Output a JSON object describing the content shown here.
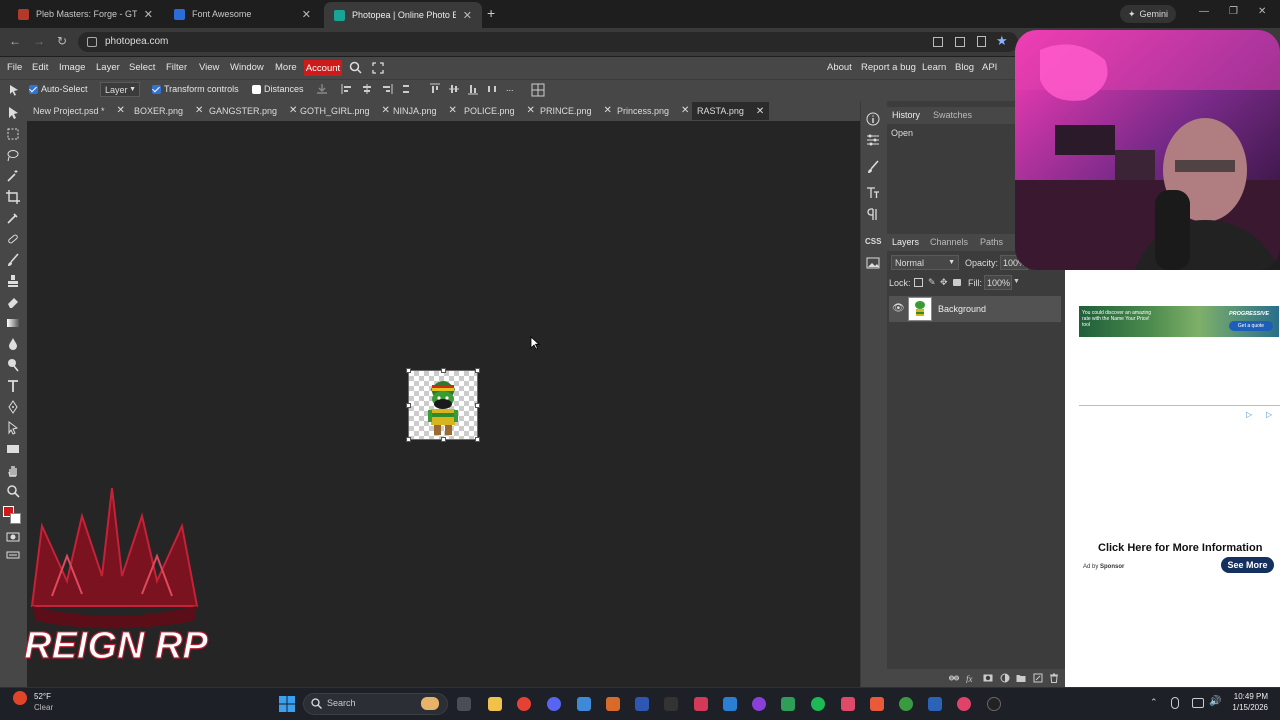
{
  "browser": {
    "tabs": [
      {
        "label": "Pleb Masters: Forge - GTA V Ol",
        "favicon_color": "#b33a2a",
        "active": false
      },
      {
        "label": "Font Awesome",
        "favicon_color": "#2b6cd8",
        "active": false
      },
      {
        "label": "Photopea | Online Photo Editor",
        "favicon_color": "#18a497",
        "active": true
      }
    ],
    "new_tab": "+",
    "gemini_label": "Gemini",
    "url": "photopea.com"
  },
  "photopea": {
    "menu": [
      "File",
      "Edit",
      "Image",
      "Layer",
      "Select",
      "Filter",
      "View",
      "Window",
      "More"
    ],
    "account_label": "Account",
    "right_links": [
      "About",
      "Report a bug",
      "Learn",
      "Blog",
      "API"
    ],
    "options": {
      "auto_select_label": "Auto-Select",
      "auto_select_checked": true,
      "layer_mode": "Layer",
      "transform_controls_label": "Transform controls",
      "transform_controls_checked": true,
      "distances_label": "Distances",
      "distances_checked": false,
      "more": "..."
    },
    "doc_tabs": [
      {
        "label": "New Project.psd *",
        "active": false
      },
      {
        "label": "BOXER.png",
        "active": false
      },
      {
        "label": "GANGSTER.png",
        "active": false
      },
      {
        "label": "GOTH_GIRL.png",
        "active": false
      },
      {
        "label": "NINJA.png",
        "active": false
      },
      {
        "label": "POLICE.png",
        "active": false
      },
      {
        "label": "PRINCE.png",
        "active": false
      },
      {
        "label": "Princess.png",
        "active": false
      },
      {
        "label": "RASTA.png",
        "active": true
      }
    ],
    "close_glyph": "✕",
    "history_panel": {
      "tabs": [
        "History",
        "Swatches"
      ],
      "items": [
        "Open"
      ]
    },
    "layers_panel": {
      "tabs": [
        "Layers",
        "Channels",
        "Paths"
      ],
      "blend_mode": "Normal",
      "opacity_label": "Opacity:",
      "opacity_value": "100%",
      "lock_label": "Lock:",
      "fill_label": "Fill:",
      "fill_value": "100%",
      "layers": [
        {
          "name": "Background",
          "visible": true
        }
      ]
    },
    "foreground_color": "#d01818",
    "background_color": "#ffffff"
  },
  "ads": {
    "banner_text": "You could discover an amazing rate with the Name Your Price! tool",
    "banner_brand": "PROGRESSIVE",
    "banner_cta": "Get a quote",
    "info_text": "Click Here for More Information",
    "ad_by": "Ad by",
    "sponsor": "Sponsor",
    "see_more": "See More"
  },
  "overlay_logo": {
    "text": "REIGN RP"
  },
  "taskbar": {
    "weather_temp": "52°F",
    "weather_desc": "Clear",
    "search_label": "Search",
    "time": "10:49 PM",
    "date": "1/15/2026"
  }
}
